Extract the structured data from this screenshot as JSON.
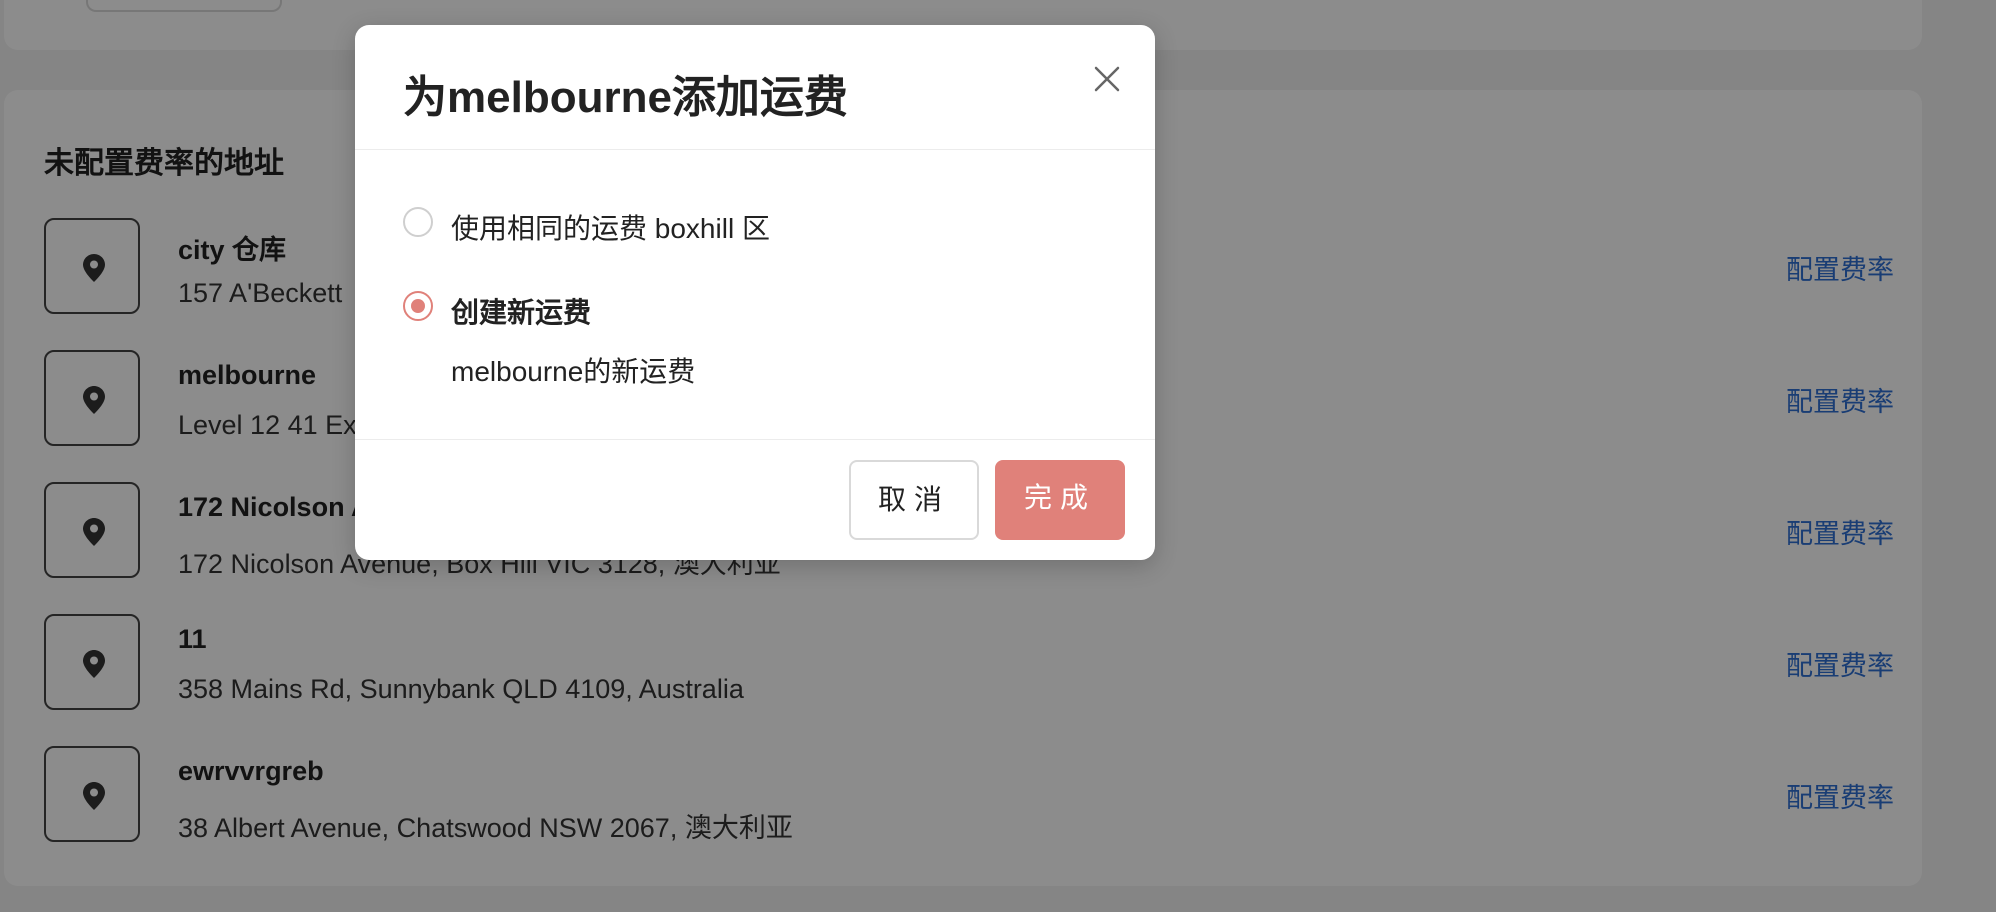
{
  "section": {
    "title": "未配置费率的地址"
  },
  "addresses": [
    {
      "name": "city 仓库",
      "address": "157 A'Beckett",
      "action": "配置费率"
    },
    {
      "name": "melbourne",
      "address": "Level 12 41 Ex",
      "action": "配置费率"
    },
    {
      "name": "172 Nicolson A",
      "address": "172 Nicolson Avenue, Box Hill VIC 3128, 澳大利亚",
      "action": "配置费率"
    },
    {
      "name": "11",
      "address": "358 Mains Rd, Sunnybank QLD 4109, Australia",
      "action": "配置费率"
    },
    {
      "name": "ewrvvrgreb",
      "address": "38 Albert Avenue, Chatswood NSW 2067, 澳大利亚",
      "action": "配置费率"
    }
  ],
  "modal": {
    "title": "为melbourne添加运费",
    "options": [
      {
        "label": "使用相同的运费 boxhill 区",
        "checked": false
      },
      {
        "label": "创建新运费",
        "checked": true
      }
    ],
    "new_rate_name": "melbourne的新运费",
    "cancel_label": "取消",
    "done_label": "完成"
  },
  "colors": {
    "accent": "#e0817a",
    "link": "#2f6fd4"
  }
}
